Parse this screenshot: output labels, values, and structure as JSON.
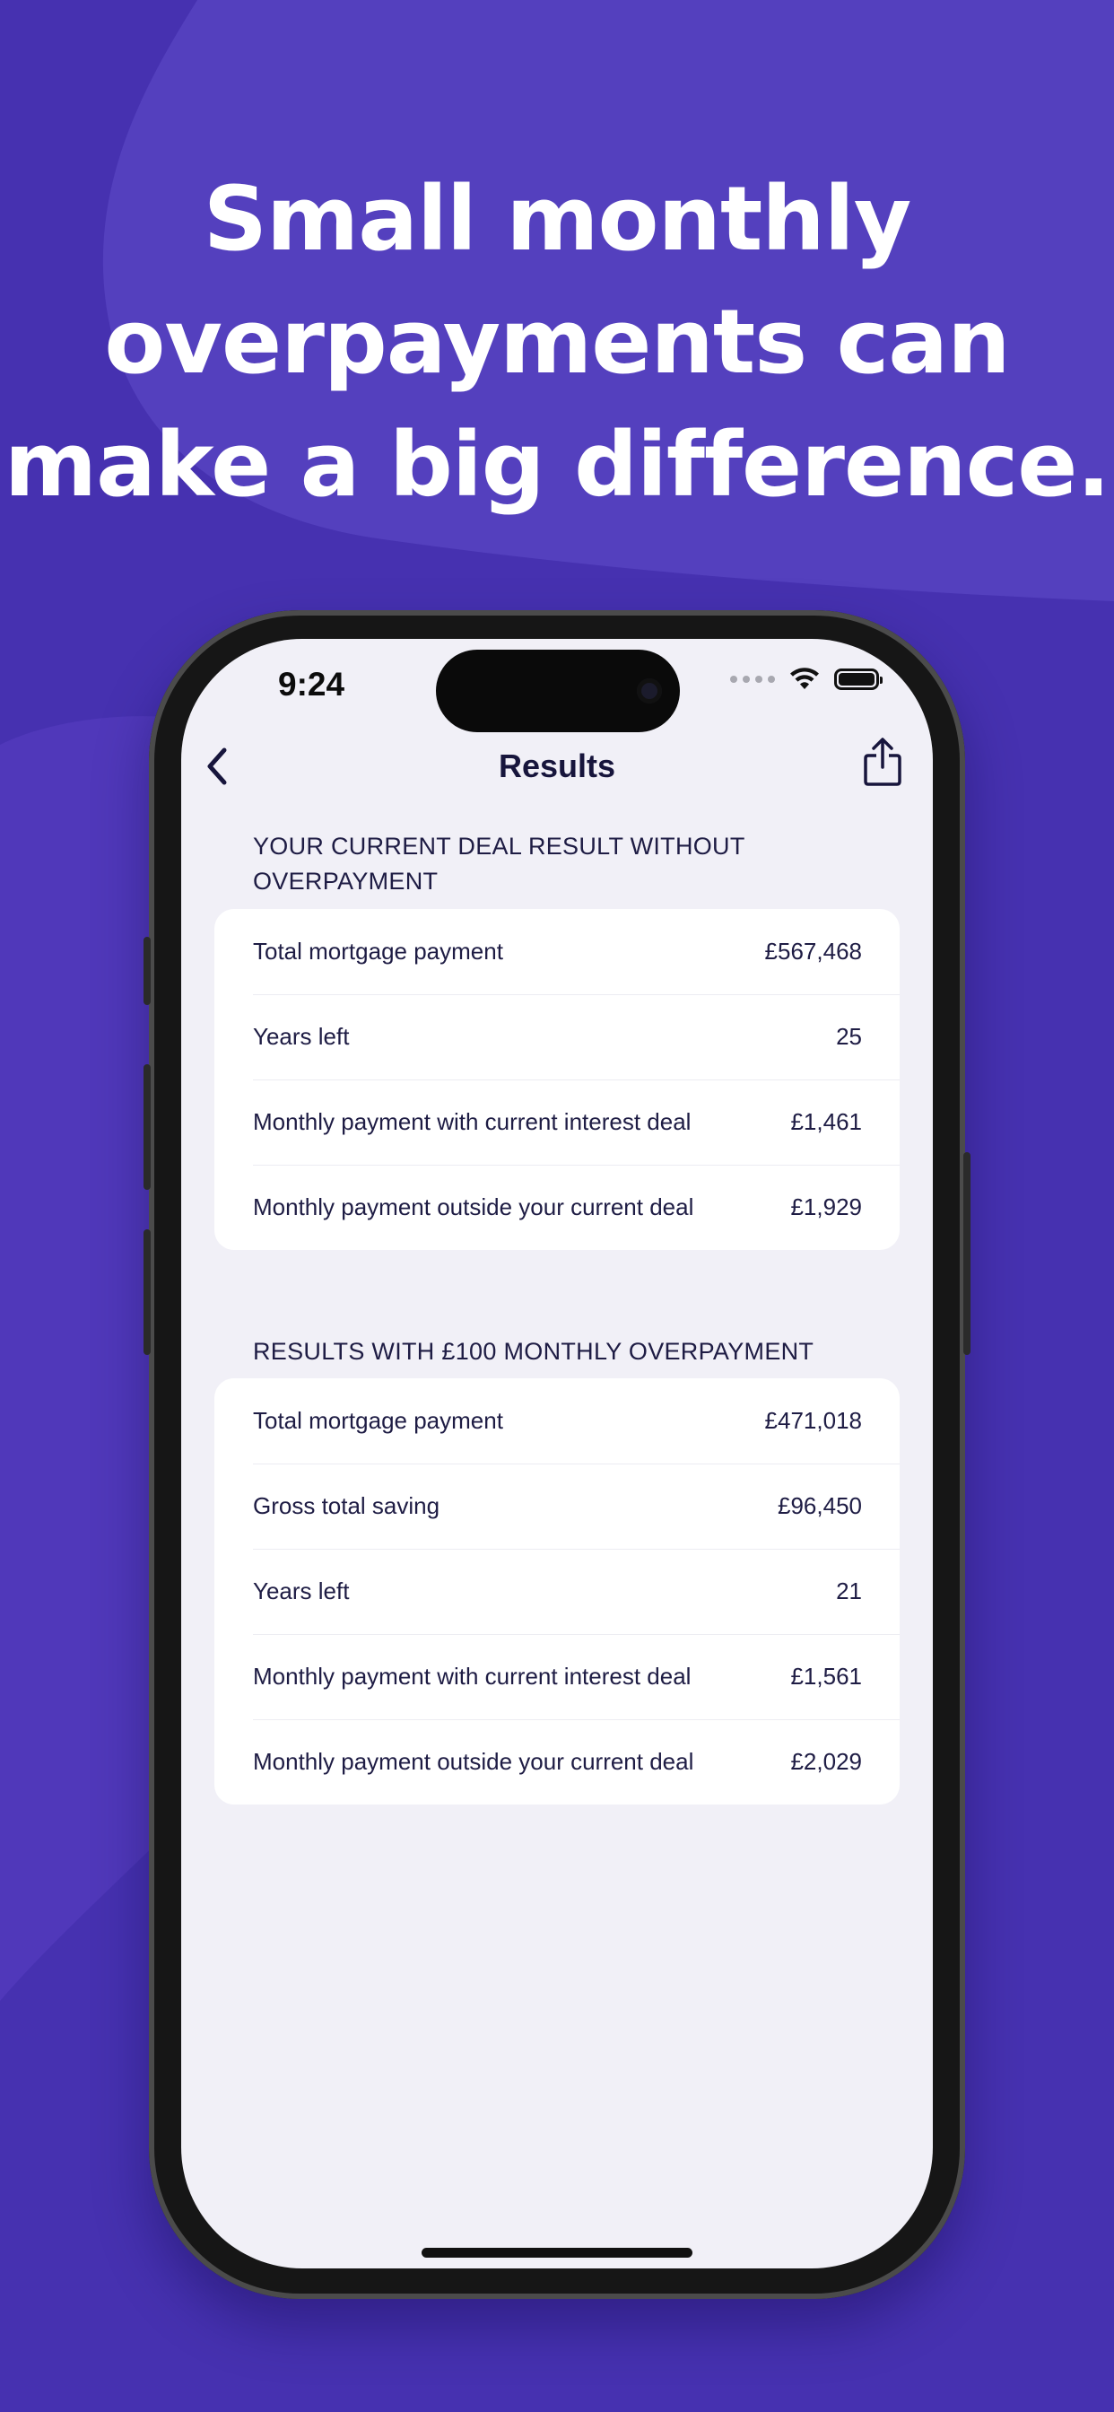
{
  "headline": {
    "line1": "Small monthly",
    "line2": "overpayments can",
    "line3": "make a big difference."
  },
  "status_bar": {
    "time": "9:24",
    "icons": [
      "signal-dots-icon",
      "wifi-icon",
      "battery-icon"
    ]
  },
  "nav": {
    "title": "Results",
    "back_icon": "chevron-left-icon",
    "share_icon": "share-icon"
  },
  "sections": [
    {
      "title": "YOUR CURRENT DEAL RESULT WITHOUT OVERPAYMENT",
      "rows": [
        {
          "label": "Total mortgage payment",
          "value": "£567,468"
        },
        {
          "label": "Years left",
          "value": "25"
        },
        {
          "label": "Monthly payment with current interest deal",
          "value": "£1,461"
        },
        {
          "label": "Monthly payment outside your current deal",
          "value": "£1,929"
        }
      ]
    },
    {
      "title": "RESULTS WITH £100 MONTHLY OVERPAYMENT",
      "rows": [
        {
          "label": "Total mortgage payment",
          "value": "£471,018"
        },
        {
          "label": "Gross total saving",
          "value": "£96,450"
        },
        {
          "label": "Years left",
          "value": "21"
        },
        {
          "label": "Monthly payment with current interest deal",
          "value": "£1,561"
        },
        {
          "label": "Monthly payment outside your current deal",
          "value": "£2,029"
        }
      ]
    }
  ],
  "colors": {
    "background": "#4631b0",
    "background_shape": "#5742bf",
    "screen_background": "#f1f0f7",
    "text_dark": "#1e1c44",
    "headline_text": "#ffffff"
  }
}
